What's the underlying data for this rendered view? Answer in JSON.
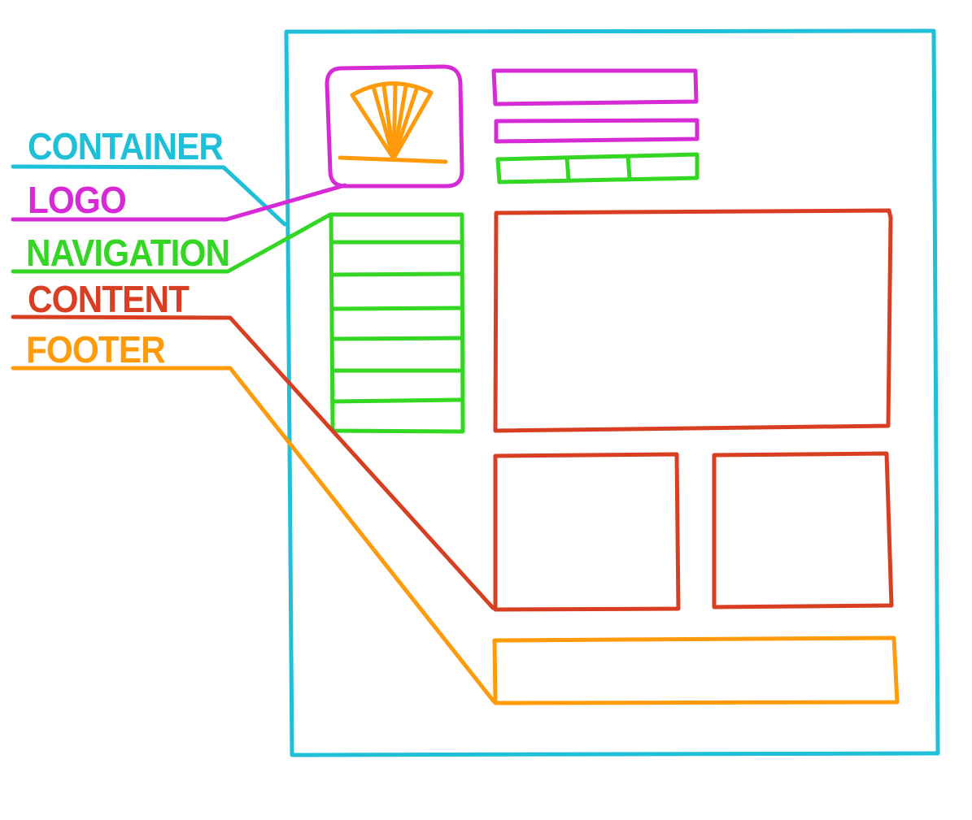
{
  "labels": {
    "container": "CONTAINER",
    "logo": "LOGO",
    "navigation": "NAVIGATION",
    "content": "CONTENT",
    "footer": "FOOTER"
  },
  "colors": {
    "container": "#1fbfd8",
    "logo": "#d62ad6",
    "navigation": "#33d622",
    "content": "#d83f22",
    "footer": "#ff9a0a",
    "background": "#ffffff"
  },
  "wireframe": {
    "navigation_item_count": 7,
    "header_nav_tab_count": 3,
    "logo_icon": "shell-icon"
  }
}
